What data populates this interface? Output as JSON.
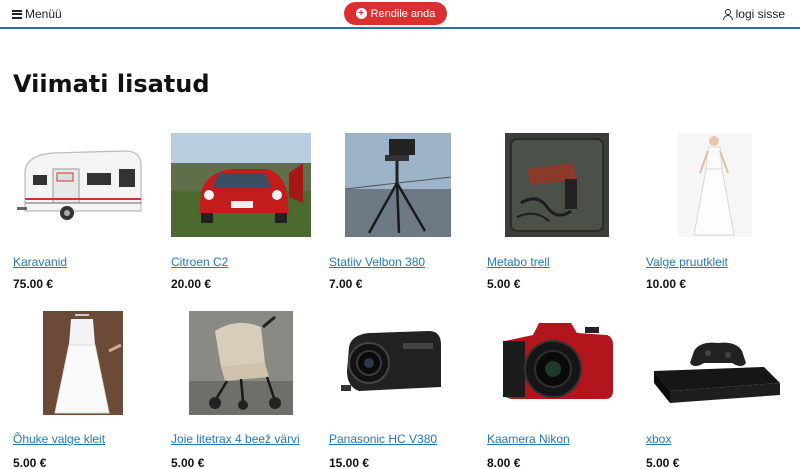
{
  "header": {
    "menu_label": "Menüü",
    "rent_label": "Rendile anda",
    "login_label": "logi sisse",
    "accent_color": "#dc2f2f",
    "divider_color": "#2a6fb0"
  },
  "section_title": "Viimati lisatud",
  "items": [
    {
      "name": "Karavanid",
      "price": "75.00 €",
      "image": "caravan"
    },
    {
      "name": "Citroen C2",
      "price": "20.00 €",
      "image": "red-car"
    },
    {
      "name": "Statiiv Velbon 380",
      "price": "7.00 €",
      "image": "tripod"
    },
    {
      "name": "Metabo trell",
      "price": "5.00 €",
      "image": "drill-case"
    },
    {
      "name": "Valge pruutkleit",
      "price": "10.00 €",
      "image": "wedding-dress"
    },
    {
      "name": "Õhuke valge kleit",
      "price": "5.00 €",
      "image": "white-dress"
    },
    {
      "name": "Joie litetrax 4 beež värvi",
      "price": "5.00 €",
      "image": "stroller"
    },
    {
      "name": "Panasonic HC V380",
      "price": "15.00 €",
      "image": "camcorder"
    },
    {
      "name": "Kaamera Nikon",
      "price": "8.00 €",
      "image": "nikon-camera"
    },
    {
      "name": "xbox",
      "price": "5.00 €",
      "image": "xbox-console"
    }
  ]
}
